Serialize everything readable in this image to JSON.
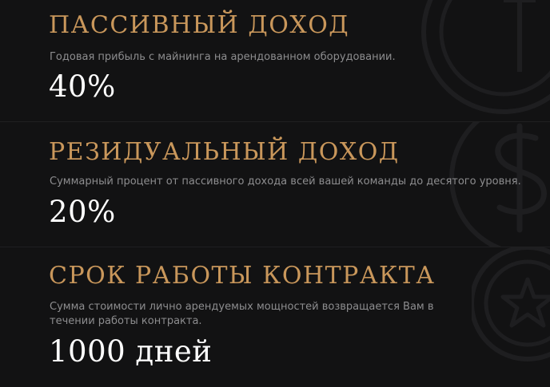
{
  "colors": {
    "background": "#121213",
    "accent_gold": "#c9975b",
    "text_muted": "#8d8d8f",
    "value_white": "#ffffff",
    "decoration": "#1e1e20"
  },
  "sections": [
    {
      "title": "ПАССИВНЫЙ ДОХОД",
      "description": "Годовая прибыль с майнинга на арендованном оборудовании.",
      "value": "40%",
      "icon": "coin-icon"
    },
    {
      "title": "РЕЗИДУАЛЬНЫЙ ДОХОД",
      "description": "Суммарный процент от пассивного дохода всей вашей команды до десятого уровня.",
      "value": "20%",
      "icon": "dollar-coin-icon"
    },
    {
      "title": "СРОК РАБОТЫ КОНТРАКТА",
      "description": "Сумма стоимости лично арендуемых мощностей возвращается Вам в течении работы контракта.",
      "value": "1000 дней",
      "icon": "star-coin-icon"
    }
  ]
}
